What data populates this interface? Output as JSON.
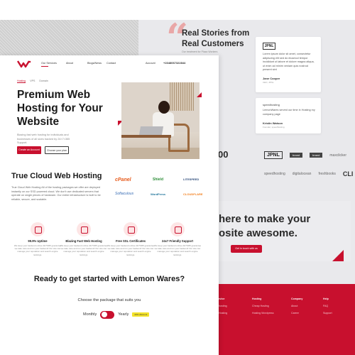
{
  "testimonials": {
    "title": "Real Stories from Real Customers",
    "subtitle": "Our treatment for Plaza Workers",
    "cards": [
      {
        "logo": "JPNL",
        "text": "Lorem ipsum dolor sit amet, consectetur adipiscing elit sed do eiusmod tempor incididunt ut labore et dolore magna aliqua, ut enim ad minim veniam quis nostrud present sint",
        "name": "Jane Cooper",
        "role": "CEO, JPNL"
      },
      {
        "logo": "speedhosting",
        "text": "LemonWares served our time in Hosting my company page",
        "name": "Kristin Watson",
        "role": "Founder, speedhosting"
      }
    ]
  },
  "stat": "00",
  "logos_row1": [
    "JPNL",
    "brand",
    "brand",
    "maxclicker"
  ],
  "logos_row2": [
    "speedhosting",
    "digitalocean",
    "freshbooks",
    "CLI"
  ],
  "cta": {
    "line1": "here to make your",
    "line2": "osite awesome.",
    "button": "Get in touch with us"
  },
  "footer": {
    "columns": [
      {
        "heading": "rvice",
        "items": [
          "",
          "hosting",
          "Hosting"
        ]
      },
      {
        "heading": "Hosting",
        "items": [
          "Cheap Hosting",
          "Hosting Wordpress"
        ]
      },
      {
        "heading": "Company",
        "items": [
          "About",
          "Career"
        ]
      },
      {
        "heading": "Help",
        "items": [
          "FAQ",
          "Support"
        ]
      }
    ]
  },
  "nav": {
    "items": [
      "Our Services",
      "About",
      "Blogs/News",
      "Contact",
      "Account"
    ],
    "phone": "+2348067322844"
  },
  "hero": {
    "tabs": [
      "Hosting",
      "VPS",
      "Domain"
    ],
    "title": "Premium Web Hosting for Your Website",
    "description": "Blazing fast web hosting for individuals and businesses of all sizes backed by 24×7×365 Support.",
    "btn_primary": "Create an Account",
    "btn_secondary": "Choose your plan"
  },
  "cloud": {
    "title": "True Cloud Web  Hosting",
    "description": "True Cloud Web Hosting All of the hosting packages we offer are deployed instantly on our SSD powered cloud. We don't use dedicated servers that operate on single pieces of hardware. Our entire infrastructure is built to be reliable, secure, and scalable.",
    "partners": [
      "cPanel",
      "Shield",
      "LITESPEED",
      "Softaculous",
      "WordPress",
      "CLOUDFLARE"
    ]
  },
  "features": [
    {
      "title": "99.9% Uptime",
      "desc": "We keep your backend online 24/7/365 guarantee we take care and run your backend! Our site can manage your reputation and search engine rankings."
    },
    {
      "title": "Blazing Fast Web Hosting",
      "desc": "We keep your backend online 24/7/365 guarantee we take care and run your backend! Our site can manage your reputation and search engine rankings."
    },
    {
      "title": "Free SSL Certificates",
      "desc": "We keep your backend online 24/7/365 guarantee we take care and run your backend! Our site can manage your reputation and search engine rankings."
    },
    {
      "title": "24x7 Friendly Support",
      "desc": "We keep your backend online 24/7/365 guarantee we take care and run your backend! Our site can manage your reputation and search engine rankings."
    }
  ],
  "pricing": {
    "title": "Ready to get started with Lemon Wares?",
    "subtitle": "Choose the package that suits you",
    "monthly": "Monthly",
    "yearly": "Yearly",
    "badge": "20% discount"
  },
  "colors": {
    "accent": "#c8102e",
    "badge": "#f3e22a"
  }
}
